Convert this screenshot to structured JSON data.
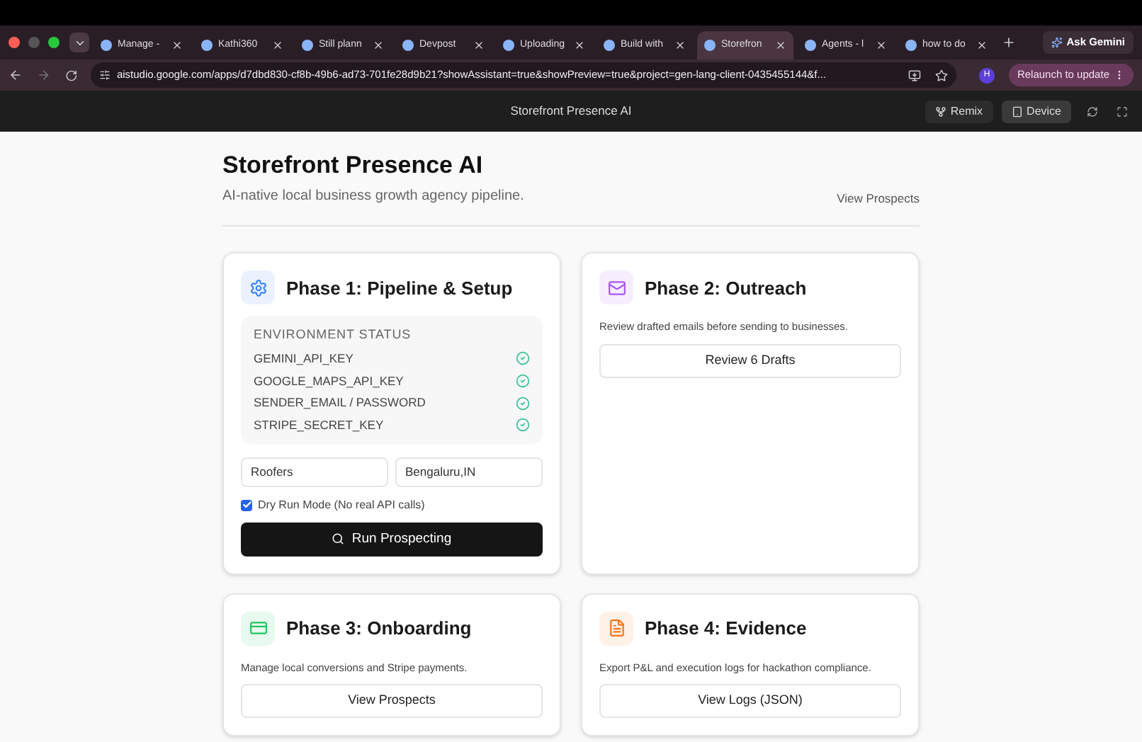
{
  "browser": {
    "tabs": [
      {
        "label": "Manage -",
        "selected": false
      },
      {
        "label": "Kathi360",
        "selected": false
      },
      {
        "label": "Still plann",
        "selected": false
      },
      {
        "label": "Devpost",
        "selected": false
      },
      {
        "label": "Uploading",
        "selected": false
      },
      {
        "label": "Build with",
        "selected": false
      },
      {
        "label": "Storefron",
        "selected": true
      },
      {
        "label": "Agents - l",
        "selected": false
      },
      {
        "label": "how to do",
        "selected": false
      }
    ],
    "ask_button": "Ask Gemini",
    "url": "aistudio.google.com/apps/d7dbd830-cf8b-49b6-ad73-701fe28d9b21?showAssistant=true&showPreview=true&project=gen-lang-client-0435455144&f...",
    "profile": "H",
    "relaunch_button": "Relaunch to update"
  },
  "app_header": {
    "title": "Storefront Presence AI",
    "remix_button": "Remix",
    "device_button": "Device"
  },
  "page": {
    "title": "Storefront Presence AI",
    "subtitle": "AI-native local business growth agency pipeline.",
    "link": "View Prospects"
  },
  "phases": [
    {
      "kind": "setup",
      "title": "Phase 1: Pipeline & Setup",
      "color": "#3b82f6",
      "env_heading": "ENVIRONMENT STATUS",
      "env": [
        {
          "name": "GEMINI_API_KEY",
          "ok": true
        },
        {
          "name": "GOOGLE_MAPS_API_KEY",
          "ok": true
        },
        {
          "name": "SENDER_EMAIL / PASSWORD",
          "ok": true
        },
        {
          "name": "STRIPE_SECRET_KEY",
          "ok": true
        }
      ],
      "niche_value": "Roofers",
      "location_value": "Bengaluru,IN",
      "dry_run": {
        "label": "Dry Run Mode (No real API calls)",
        "checked": true
      },
      "button": "Run Prospecting"
    },
    {
      "kind": "simple",
      "title": "Phase 2: Outreach",
      "color": "#a855f7",
      "description": "Review drafted emails before sending to businesses.",
      "button": "Review 6 Drafts"
    },
    {
      "kind": "simple",
      "title": "Phase 3: Onboarding",
      "color": "#22c55e",
      "description": "Manage local conversions and Stripe payments.",
      "button": "View Prospects"
    },
    {
      "kind": "simple",
      "title": "Phase 4: Evidence",
      "color": "#f97316",
      "description": "Export P&L and execution logs for hackathon compliance.",
      "button": "View Logs (JSON)"
    }
  ]
}
